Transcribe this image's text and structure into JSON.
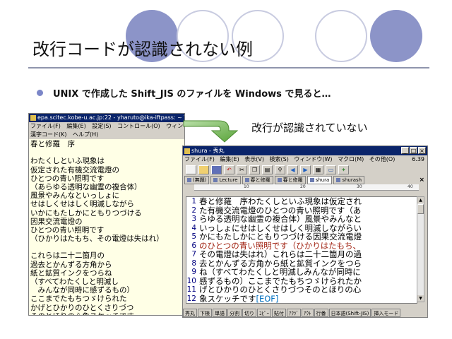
{
  "slide": {
    "title": "改行コードが認識されない例",
    "bullet": "UNIX で作成した Shift_JIS のファイルを Windows で見ると…",
    "arrow_caption": "改行が認識されていない",
    "colors": {
      "circle_fill": "#8c94c8",
      "circle_outline": "#c8cbe0",
      "bullet": "#7b86c8"
    }
  },
  "left_window": {
    "title": "epa.scitec.kobe-u.ac.jp:22 - yharuto@ika-iftpass: ~ VT",
    "menu": [
      "ファイル(F)",
      "編集(E)",
      "設定(S)",
      "コントロール(O)",
      "ウィン"
    ],
    "menu2": [
      "漢字コード(K)",
      "ヘルプ(H)"
    ],
    "lines": [
      "春と修羅　序",
      "",
      "わたくしといふ現象は",
      "仮定された有機交流電燈の",
      "ひとつの青い照明です",
      "（あらゆる透明な幽霊の複合体）",
      "風景やみんなといっしょに",
      "せはしくせはしく明滅しながら",
      "いかにもたしかにともりつづける",
      "因果交流電燈の",
      "ひとつの青い照明です",
      "（ひかりはたもち、その電燈は失はれ）",
      "",
      "これらは二十二箇月の",
      "過去とかんずる方角から",
      "紙と鉱質インクをつらね",
      "（すべてわたくしと明滅し",
      "　みんなが同時に感ずるもの）",
      "ここまでたもちつゞけられた",
      "かげとひかりのひとくさりづつ",
      "そのとほりの心象スケッチです",
      "_"
    ]
  },
  "right_window": {
    "title": "shura - 秀丸",
    "controls": [
      "_",
      "□",
      "×"
    ],
    "menu": [
      "ファイル(F)",
      "編集(E)",
      "表示(V)",
      "検索(S)",
      "ウィンドウ(W)",
      "マクロ(M)",
      "その他(O)"
    ],
    "version": "6.39",
    "toolbar_icons": [
      "new-icon",
      "open-icon",
      "save-icon",
      "undo-icon",
      "cut-icon",
      "copy-icon",
      "paste-icon",
      "search-icon",
      "prev-icon",
      "next-icon",
      "grep-icon",
      "window-icon",
      "gear-icon"
    ],
    "tabs": [
      "(無題)",
      "Lecture",
      "春と修羅",
      "春と修羅",
      "shura",
      "shurash"
    ],
    "active_tab": 4,
    "ruler": [
      "10",
      "20",
      "30",
      "40"
    ],
    "lines": [
      {
        "n": "1",
        "t": "春と修羅　序わたくしといふ現象は仮定され"
      },
      {
        "n": "2",
        "t": "た有機交流電燈のひとつの青い照明です（あ"
      },
      {
        "n": "3",
        "t": "らゆる透明な幽霊の複合体）風景やみんなと"
      },
      {
        "n": "4",
        "t": "いっしょにせはしくせはしく明滅しながらい"
      },
      {
        "n": "5",
        "t": "かにもたしかにともりつづける因果交流電燈"
      },
      {
        "n": "6",
        "t": "のひとつの青い照明です（ひかりはたもち、",
        "alt": true
      },
      {
        "n": "7",
        "t": "その電燈は失はれ）これらは二十二箇月の過"
      },
      {
        "n": "8",
        "t": "去とかんずる方角から紙と鉱質インクをつら"
      },
      {
        "n": "9",
        "t": "ね（すべてわたくしと明滅しみんなが同時に"
      },
      {
        "n": "10",
        "t": "感ずるもの）ここまでたもちつゞけられたか"
      },
      {
        "n": "11",
        "t": "げとひかりのひとくさりづつそのとほりの心"
      },
      {
        "n": "12",
        "t": "象スケッチです",
        "eof": "[EOF]"
      }
    ],
    "status": [
      "秀丸",
      "下検",
      "単語",
      "分割",
      "切り",
      "ｺﾋﾟｰ",
      "貼付",
      "ｱｸﾂﾞ",
      "ｱｳﾄ",
      "行番",
      "日本語(Shift-JIS)",
      "挿入モード"
    ]
  }
}
